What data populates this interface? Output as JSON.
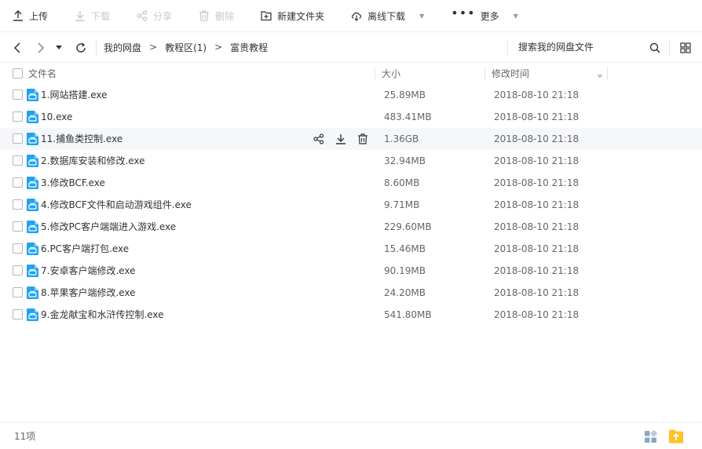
{
  "toolbar": {
    "upload": "上传",
    "download": "下载",
    "share": "分享",
    "delete": "删除",
    "new_folder": "新建文件夹",
    "offline_download": "离线下载",
    "more": "更多"
  },
  "nav": {
    "breadcrumbs": [
      "我的网盘",
      "教程区(1)",
      "富贵教程"
    ],
    "search_label": "搜索我的网盘文件"
  },
  "table": {
    "headers": {
      "name": "文件名",
      "size": "大小",
      "modified": "修改时间"
    },
    "rows": [
      {
        "name": "1.网站搭建.exe",
        "size": "25.89MB",
        "modified": "2018-08-10 21:18"
      },
      {
        "name": "10.exe",
        "size": "483.41MB",
        "modified": "2018-08-10 21:18"
      },
      {
        "name": "11.捕鱼类控制.exe",
        "size": "1.36GB",
        "modified": "2018-08-10 21:18"
      },
      {
        "name": "2.数据库安装和修改.exe",
        "size": "32.94MB",
        "modified": "2018-08-10 21:18"
      },
      {
        "name": "3.修改BCF.exe",
        "size": "8.60MB",
        "modified": "2018-08-10 21:18"
      },
      {
        "name": "4.修改BCF文件和启动游戏组件.exe",
        "size": "9.71MB",
        "modified": "2018-08-10 21:18"
      },
      {
        "name": "5.修改PC客户端端进入游戏.exe",
        "size": "229.60MB",
        "modified": "2018-08-10 21:18"
      },
      {
        "name": "6.PC客户端打包.exe",
        "size": "15.46MB",
        "modified": "2018-08-10 21:18"
      },
      {
        "name": "7.安卓客户端修改.exe",
        "size": "90.19MB",
        "modified": "2018-08-10 21:18"
      },
      {
        "name": "8.苹果客户端修改.exe",
        "size": "24.20MB",
        "modified": "2018-08-10 21:18"
      },
      {
        "name": "9.金龙献宝和水浒传控制.exe",
        "size": "541.80MB",
        "modified": "2018-08-10 21:18"
      }
    ]
  },
  "footer": {
    "count": "11项"
  },
  "colors": {
    "accent": "#0099ff",
    "file_icon": "#1fa3f5",
    "folder_up": "#ffc125"
  }
}
